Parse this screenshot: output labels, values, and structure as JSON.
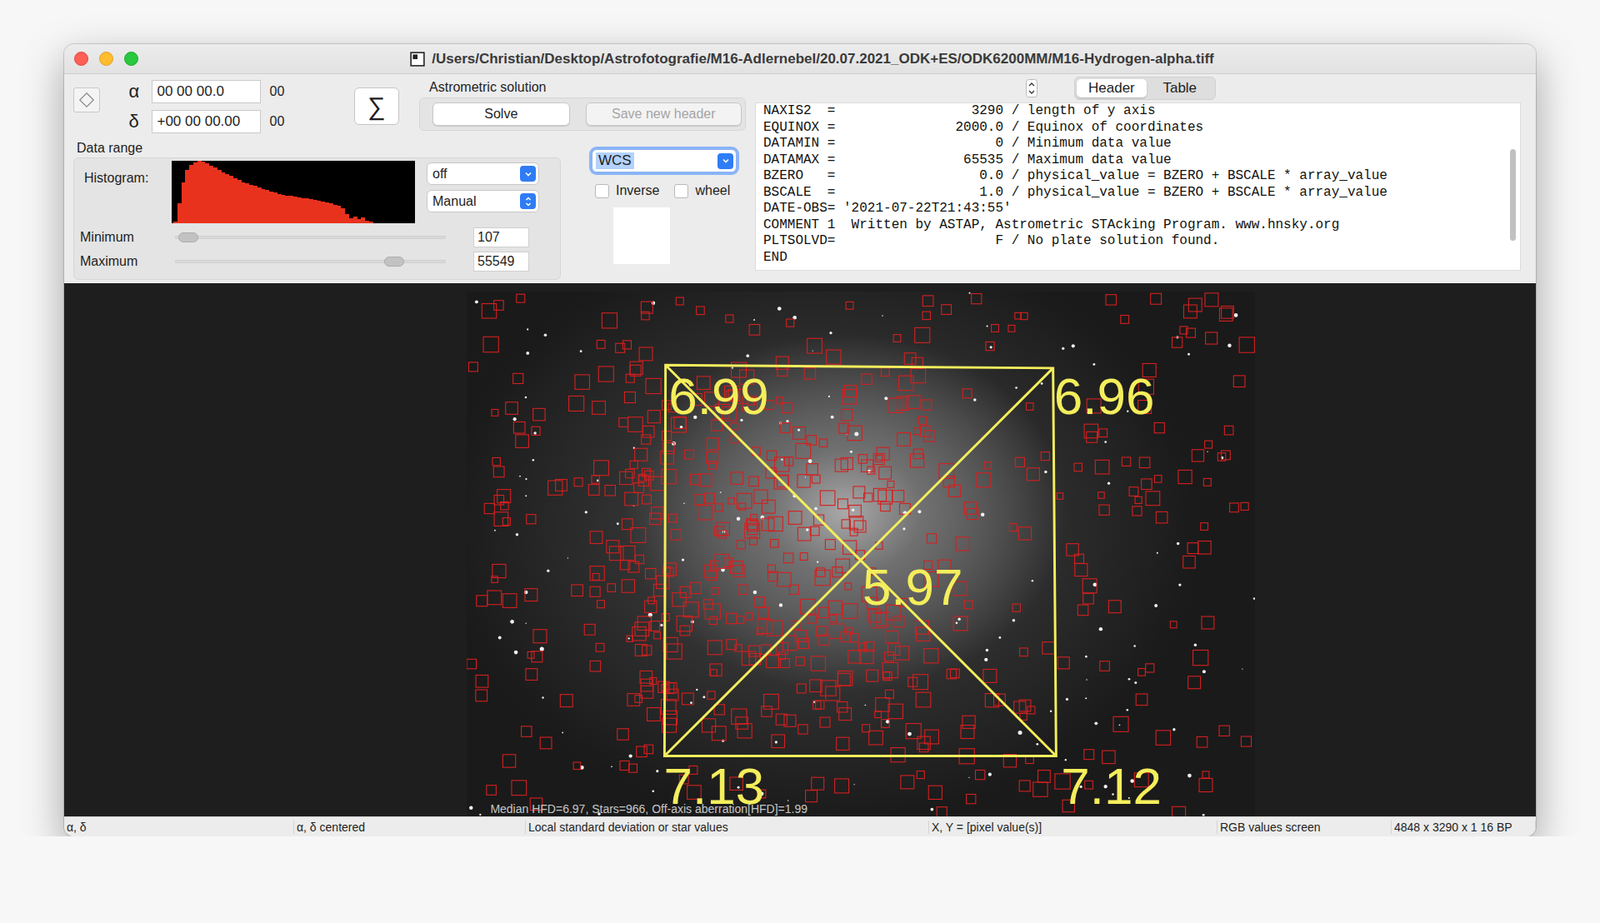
{
  "window": {
    "title": "/Users/Christian/Desktop/Astrofotografie/M16-Adlernebel/20.07.2021_ODK+ES/ODK6200MM/M16-Hydrogen-alpha.tiff"
  },
  "coordinates": [
    {
      "symbol": "α",
      "value": "00 00 00.0",
      "suffix": "00"
    },
    {
      "symbol": "δ",
      "value": "+00 00 00.00",
      "suffix": "00"
    }
  ],
  "sigma_button": "∑",
  "astrometric": {
    "label": "Astrometric solution",
    "buttons": [
      {
        "label": "Solve",
        "disabled": false
      },
      {
        "label": "Save new header",
        "disabled": true
      }
    ]
  },
  "data_range": {
    "label": "Data range",
    "histogram_label": "Histogram:",
    "histogram": [
      2,
      30,
      62,
      80,
      88,
      92,
      94,
      93,
      90,
      87,
      84,
      80,
      77,
      74,
      71,
      68,
      65,
      62,
      60,
      58,
      56,
      54,
      52,
      50,
      48,
      46,
      44,
      43,
      42,
      41,
      40,
      39,
      38,
      37,
      36,
      35,
      34,
      33,
      31,
      30,
      28,
      26,
      22,
      14,
      8,
      10,
      6,
      9,
      4,
      3,
      0,
      0,
      0,
      0,
      0,
      0,
      0,
      0,
      0,
      0
    ],
    "dropdowns": [
      {
        "label": "off",
        "kind": "pulldown"
      },
      {
        "label": "Manual",
        "kind": "popup"
      }
    ],
    "sliders": [
      {
        "label": "Minimum",
        "level": 0.05,
        "value": "107"
      },
      {
        "label": "Maximum",
        "level": 0.81,
        "value": "55549"
      }
    ]
  },
  "overlay": {
    "dropdown": "WCS",
    "checkboxes": [
      {
        "label": "Inverse",
        "checked": false
      },
      {
        "label": "wheel",
        "checked": false
      }
    ]
  },
  "tabs": [
    {
      "label": "Header",
      "selected": true
    },
    {
      "label": "Table",
      "selected": false
    }
  ],
  "header_lines": [
    "NAXIS2  =                 3290 / length of y axis",
    "EQUINOX =               2000.0 / Equinox of coordinates",
    "DATAMIN =                    0 / Minimum data value",
    "DATAMAX =                65535 / Maximum data value",
    "BZERO   =                  0.0 / physical_value = BZERO + BSCALE * array_value",
    "BSCALE  =                  1.0 / physical_value = BZERO + BSCALE * array_value",
    "DATE-OBS= '2021-07-22T21:43:55'",
    "COMMENT 1  Written by ASTAP, Astrometric STAcking Program. www.hnsky.org",
    "PLTSOLVD=                    F / No plate solution found.",
    "END"
  ],
  "image": {
    "tilt": [
      {
        "label": "6.99",
        "corner": "top-left"
      },
      {
        "label": "6.96",
        "corner": "top-right"
      },
      {
        "label": "5.97",
        "corner": "center"
      },
      {
        "label": "7.13",
        "corner": "bottom-left"
      },
      {
        "label": "7.12",
        "corner": "bottom-right"
      }
    ],
    "caption": "Median HFD=6.97, Stars=966, Off-axis aberration[HFD]=1.99"
  },
  "status_bar": [
    "α, δ",
    "α, δ centered",
    "Local standard deviation or star values",
    "X, Y = [pixel value(s)]",
    "RGB values screen",
    "4848 x 3290 x 1  16 BP"
  ]
}
